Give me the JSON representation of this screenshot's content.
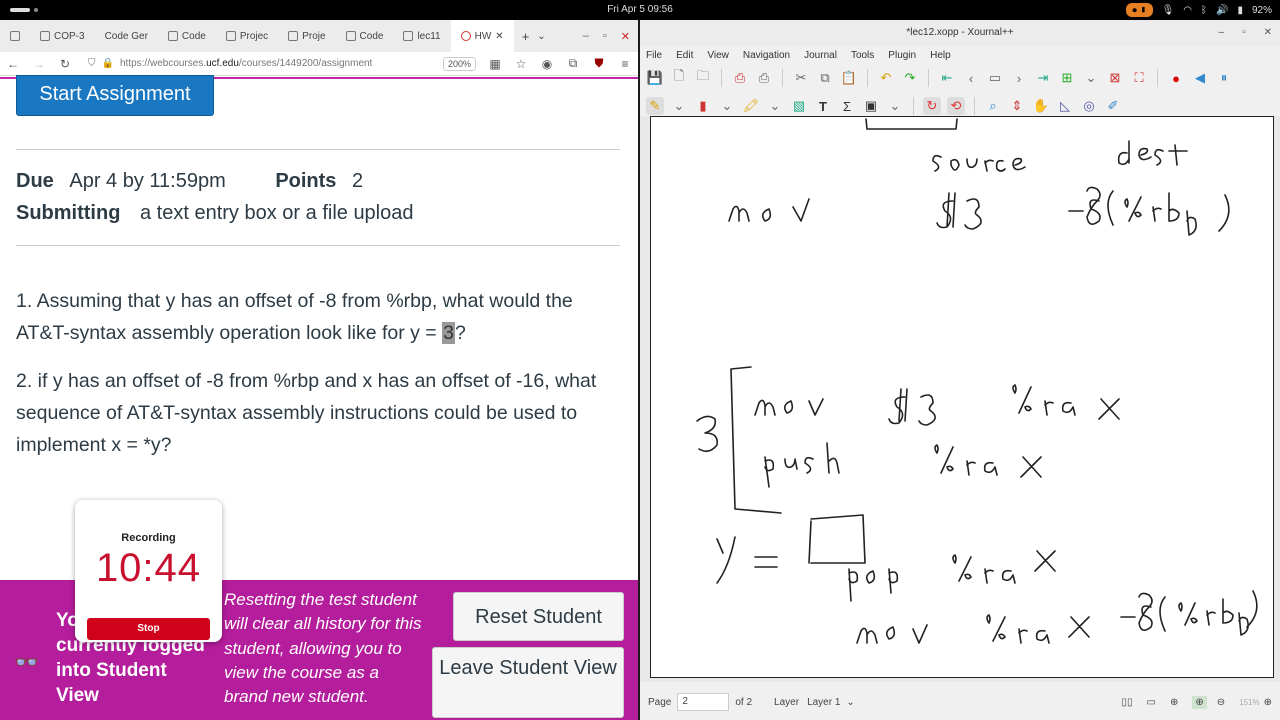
{
  "topbar": {
    "clock": "Fri Apr 5  09:56",
    "battery": "92%"
  },
  "browser": {
    "tabs": [
      "COP-3",
      "Code Ger",
      "Code",
      "Projec",
      "Proje",
      "Code",
      "lec11",
      "HW"
    ],
    "url_prefix": "https://webcourses.",
    "url_domain": "ucf.edu",
    "url_suffix": "/courses/1449200/assignment",
    "zoom": "200%"
  },
  "assignment": {
    "start_button": "Start Assignment",
    "due_label": "Due",
    "due_value": "Apr 4 by 11:59pm",
    "points_label": "Points",
    "points_value": "2",
    "submitting_label": "Submitting",
    "submitting_value": "a text entry box or a file upload",
    "q1_a": "1. Assuming that y has an offset of -8 from %rbp, what would the AT&T-syntax assembly operation look like for y = ",
    "q1_hl": "3",
    "q1_b": "?",
    "q2": "2. if y has an offset of -8 from %rbp and x has an offset of -16, what sequence of AT&T-syntax assembly instructions could be used to implement x = *y?"
  },
  "student_view": {
    "logged_in": "You are currently logged into Student View",
    "description": "Resetting the test student will clear all history for this student, allowing you to view the course as a brand new student.",
    "reset_button": "Reset Student",
    "leave_button": "Leave Student View"
  },
  "recording": {
    "label": "Recording",
    "time": "10:44",
    "stop": "Stop"
  },
  "xournal": {
    "title": "*lec12.xopp - Xournal++",
    "menu": [
      "File",
      "Edit",
      "View",
      "Navigation",
      "Journal",
      "Tools",
      "Plugin",
      "Help"
    ],
    "page_label": "Page",
    "page_value": "2",
    "page_of": "of 2",
    "layer_label": "Layer",
    "layer_value": "Layer 1",
    "zoom": "151%"
  }
}
